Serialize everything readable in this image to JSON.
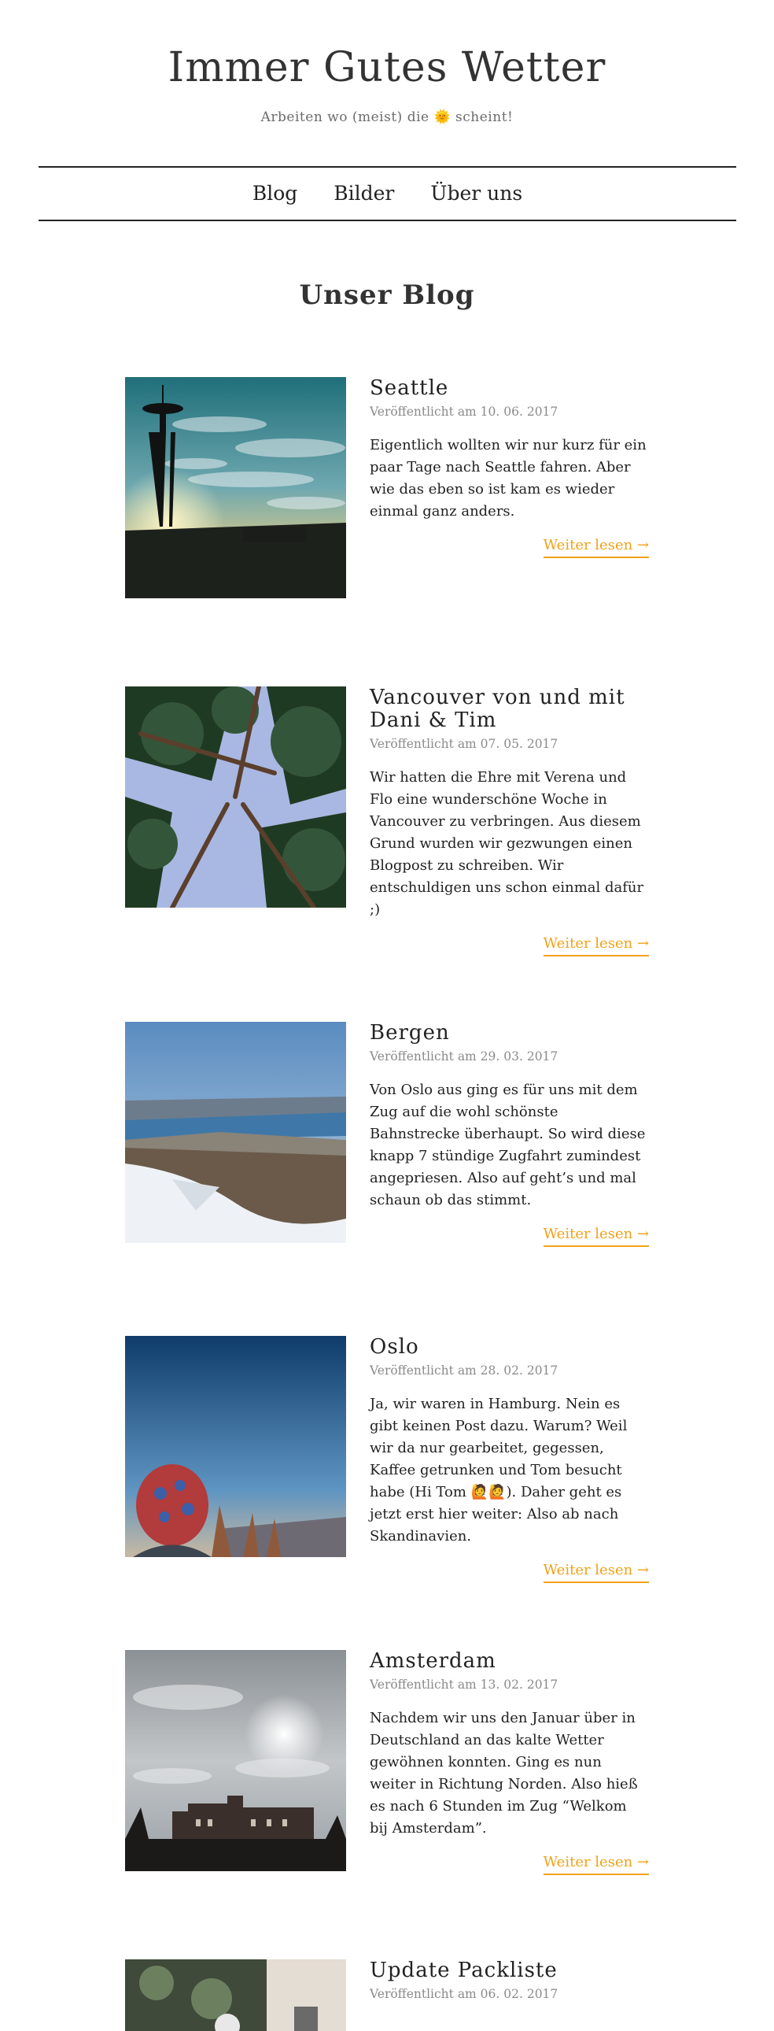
{
  "site": {
    "title": "Immer Gutes Wetter",
    "tagline": "Arbeiten wo (meist) die 🌞 scheint!"
  },
  "nav": {
    "items": [
      "Blog",
      "Bilder",
      "Über uns"
    ]
  },
  "section_title": "Unser Blog",
  "read_more_label": "Weiter lesen →",
  "posts": [
    {
      "title": "Seattle",
      "date": "Veröffentlicht am 10. 06. 2017",
      "excerpt": "Eigentlich wollten wir nur kurz für ein paar Tage nach Seattle fahren. Aber wie das eben so ist kam es wieder einmal ganz anders.",
      "image": "space-needle-sunset-photo"
    },
    {
      "title": "Vancouver von und mit Dani & Tim",
      "date": "Veröffentlicht am 07. 05. 2017",
      "excerpt": "Wir hatten die Ehre mit Verena und Flo eine wunderschöne Woche in Vancouver zu verbringen. Aus diesem Grund wurden wir gezwungen einen Blogpost zu schreiben. Wir entschuldigen uns schon einmal dafür ;)",
      "image": "forest-canopy-photo"
    },
    {
      "title": "Bergen",
      "date": "Veröffentlicht am 29. 03. 2017",
      "excerpt": "Von Oslo aus ging es für uns mit dem Zug auf die wohl schönste Bahnstrecke überhaupt. So wird diese knapp 7 stündige Zugfahrt zumindest angepriesen. Also auf geht’s und mal schaun ob das stimmt.",
      "image": "bergen-fjord-snow-photo"
    },
    {
      "title": "Oslo",
      "date": "Veröffentlicht am 28. 02. 2017",
      "excerpt": "Ja, wir waren in Hamburg. Nein es gibt keinen Post dazu. Warum? Weil wir da nur gearbeitet, gegessen, Kaffee getrunken und Tom besucht habe (Hi Tom 🙋🙋). Daher geht es jetzt erst hier weiter: Also ab nach Skandinavien.",
      "image": "oslo-beanie-skyline-photo"
    },
    {
      "title": "Amsterdam",
      "date": "Veröffentlicht am 13. 02. 2017",
      "excerpt": "Nachdem wir uns den Januar über in Deutschland an das kalte Wetter gewöhnen konnten. Ging es nun weiter in Richtung Norden. Also hieß es nach 6 Stunden im Zug “Welkom bij Amsterdam”.",
      "image": "amsterdam-cloudy-sky-photo"
    },
    {
      "title": "Update Packliste",
      "date": "Veröffentlicht am 06. 02. 2017",
      "excerpt": "",
      "image": "packing-gear-photo"
    }
  ],
  "colors": {
    "accent": "#f0a21a",
    "text": "#333333",
    "meta": "#8a8a8a",
    "rule": "#222222"
  }
}
